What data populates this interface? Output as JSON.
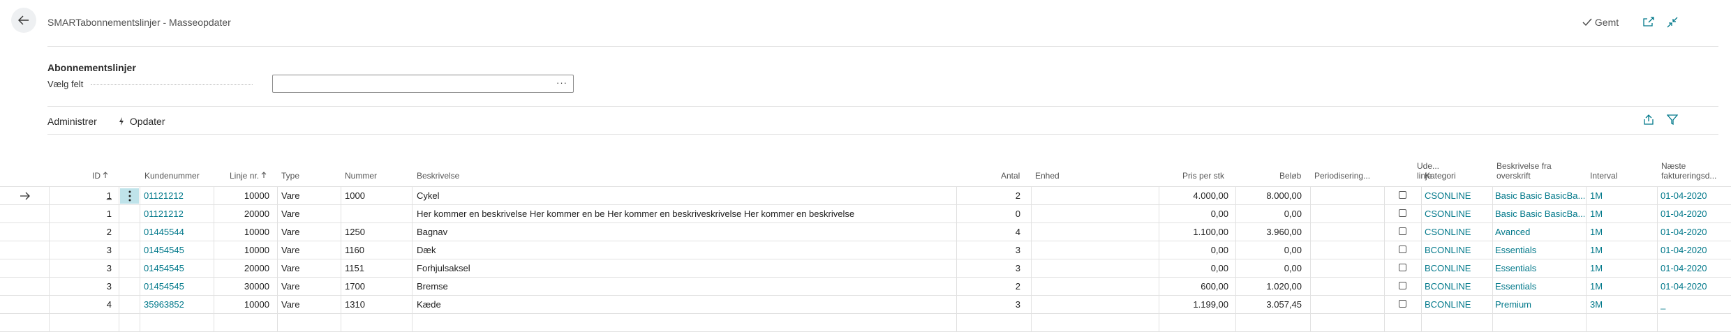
{
  "header": {
    "title": "SMARTabonnementslinjer - Masseopdater",
    "saved_label": "Gemt"
  },
  "section": {
    "title": "Abonnementslinjer",
    "field_label": "Vælg felt",
    "field_value": "",
    "lookup_label": "···"
  },
  "actions": {
    "manage": "Administrer",
    "update": "Opdater"
  },
  "table": {
    "columns": {
      "id": "ID",
      "customer": "Kundenummer",
      "line": "Linje nr.",
      "type": "Type",
      "number": "Nummer",
      "description": "Beskrivelse",
      "qty": "Antal",
      "unit": "Enhed",
      "price": "Pris per stk",
      "amount": "Beløb",
      "accrual": "Periodisering...",
      "excl_line1": "Ude...",
      "excl_line2": "linje",
      "category": "Kategori",
      "header_desc_line1": "Beskrivelse fra",
      "header_desc_line2": "overskrift",
      "interval": "Interval",
      "next_inv_line1": "Næste",
      "next_inv_line2": "faktureringsd..."
    },
    "rows": [
      {
        "id": "1",
        "customer": "01121212",
        "line": "10000",
        "type": "Vare",
        "number": "1000",
        "description": "Cykel",
        "qty": "2",
        "unit": "",
        "price": "4.000,00",
        "amount": "8.000,00",
        "accrual": "",
        "excluded": false,
        "category": "CSONLINE",
        "header_desc": "Basic Basic BasicBa...",
        "interval": "1M",
        "next_invoice": "01-04-2020"
      },
      {
        "id": "1",
        "customer": "01121212",
        "line": "20000",
        "type": "Vare",
        "number": "",
        "description": "Her kommer en beskrivelse Her kommer en be Her kommer en beskriveskrivelse Her kommer en beskrivelse",
        "qty": "0",
        "unit": "",
        "price": "0,00",
        "amount": "0,00",
        "accrual": "",
        "excluded": false,
        "category": "CSONLINE",
        "header_desc": "Basic Basic BasicBa...",
        "interval": "1M",
        "next_invoice": "01-04-2020"
      },
      {
        "id": "2",
        "customer": "01445544",
        "line": "10000",
        "type": "Vare",
        "number": "1250",
        "description": "Bagnav",
        "qty": "4",
        "unit": "",
        "price": "1.100,00",
        "amount": "3.960,00",
        "accrual": "",
        "excluded": false,
        "category": "CSONLINE",
        "header_desc": "Avanced",
        "interval": "1M",
        "next_invoice": "01-04-2020"
      },
      {
        "id": "3",
        "customer": "01454545",
        "line": "10000",
        "type": "Vare",
        "number": "1160",
        "description": "Dæk",
        "qty": "3",
        "unit": "",
        "price": "0,00",
        "amount": "0,00",
        "accrual": "",
        "excluded": false,
        "category": "BCONLINE",
        "header_desc": "Essentials",
        "interval": "1M",
        "next_invoice": "01-04-2020"
      },
      {
        "id": "3",
        "customer": "01454545",
        "line": "20000",
        "type": "Vare",
        "number": "1151",
        "description": "Forhjulsaksel",
        "qty": "3",
        "unit": "",
        "price": "0,00",
        "amount": "0,00",
        "accrual": "",
        "excluded": false,
        "category": "BCONLINE",
        "header_desc": "Essentials",
        "interval": "1M",
        "next_invoice": "01-04-2020"
      },
      {
        "id": "3",
        "customer": "01454545",
        "line": "30000",
        "type": "Vare",
        "number": "1700",
        "description": "Bremse",
        "qty": "2",
        "unit": "",
        "price": "600,00",
        "amount": "1.020,00",
        "accrual": "",
        "excluded": false,
        "category": "BCONLINE",
        "header_desc": "Essentials",
        "interval": "1M",
        "next_invoice": "01-04-2020"
      },
      {
        "id": "4",
        "customer": "35963852",
        "line": "10000",
        "type": "Vare",
        "number": "1310",
        "description": "Kæde",
        "qty": "3",
        "unit": "",
        "price": "1.199,00",
        "amount": "3.057,45",
        "accrual": "",
        "excluded": false,
        "category": "BCONLINE",
        "header_desc": "Premium",
        "interval": "3M",
        "next_invoice": "_"
      }
    ]
  },
  "icons": {
    "back": "back-arrow-icon",
    "saved": "checkmark-icon",
    "open_new": "open-in-new-window-icon",
    "collapse": "collapse-icon",
    "update": "lightning-icon",
    "share": "share-icon",
    "filter": "filter-icon",
    "row_indicator": "row-arrow-icon",
    "row_menu": "row-menu-icon",
    "sort_ascending": "sort-ascending-icon"
  },
  "colors": {
    "link": "#00788a",
    "selection": "#bfe3ea",
    "divider": "#e1e1e1"
  }
}
